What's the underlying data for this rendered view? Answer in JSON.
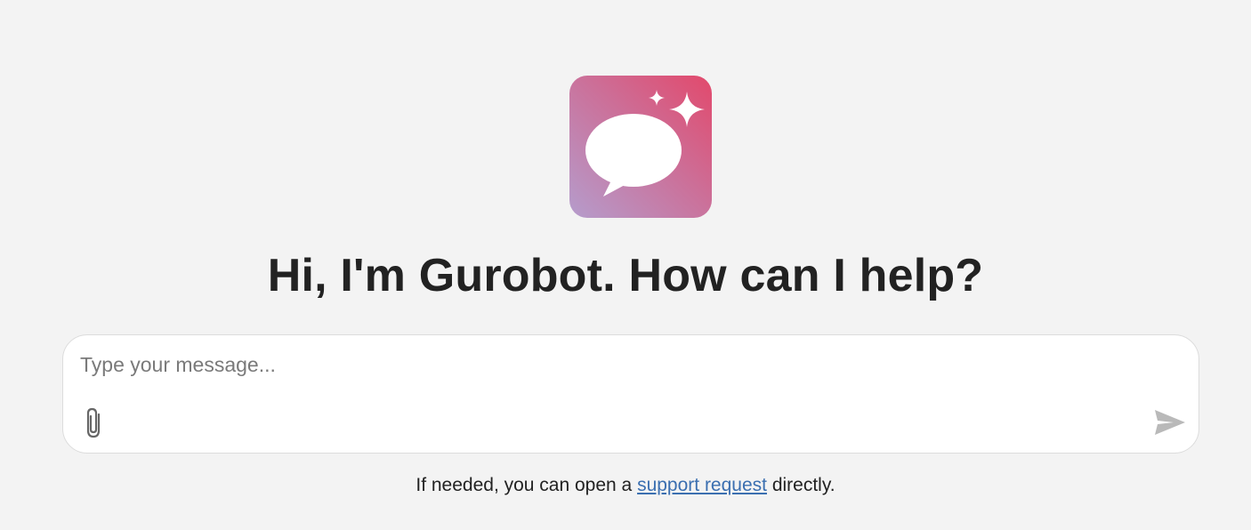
{
  "header": {
    "greeting": "Hi, I'm Gurobot. How can I help?"
  },
  "composer": {
    "placeholder": "Type your message...",
    "value": "",
    "attach_icon": "paperclip-icon",
    "send_icon": "send-icon"
  },
  "footer": {
    "text_before": "If needed, you can open a ",
    "link_label": "support request",
    "text_after": " directly."
  },
  "colors": {
    "background": "#f3f3f3",
    "logo_gradient_start": "#b49ccb",
    "logo_gradient_end": "#e05070",
    "link": "#3b6fb0"
  }
}
